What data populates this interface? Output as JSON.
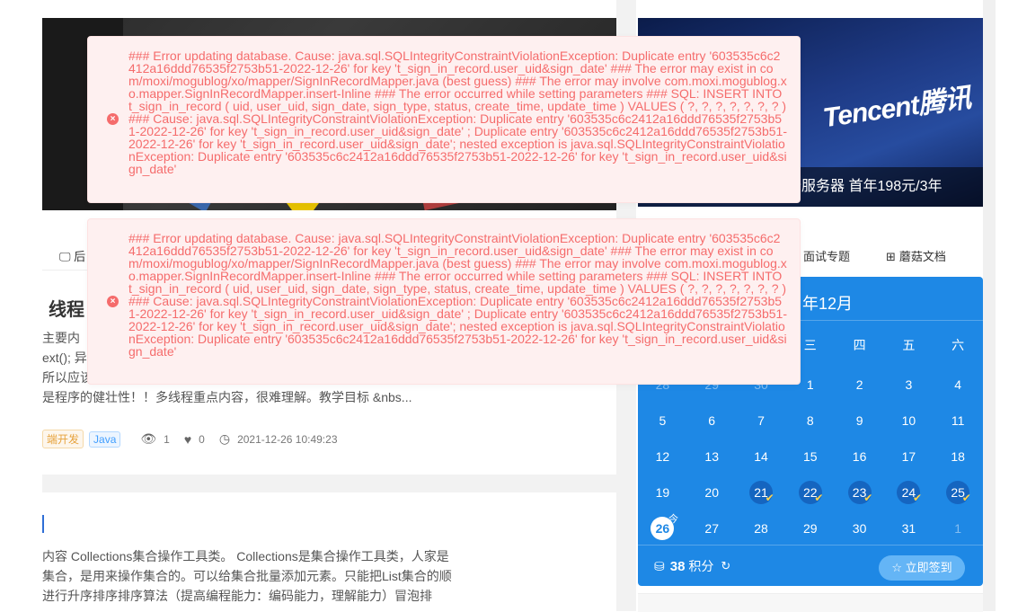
{
  "banner_right": {
    "logo": "Tencent腾讯",
    "caption": "云服务器 首年198元/3年"
  },
  "nav": {
    "left_tab": "后",
    "right_tabs": [
      {
        "icon": "",
        "label": "面试专题"
      },
      {
        "icon": "⊞",
        "label": "蘑菇文档"
      }
    ]
  },
  "article1": {
    "title": "线程",
    "lines": [
      " 主要内",
      "ext(); 异",
      "所以应该",
      "是程序的健壮性！！多线程重点内容，很难理解。教学目标 &nbs..."
    ],
    "tags": [
      "端开发",
      "Java"
    ],
    "views": "1",
    "likes": "0",
    "datetime": "2021-12-26 10:49:23"
  },
  "article2": {
    "lines": [
      "内容 Collections集合操作工具类。 Collections是集合操作工具类，人家是",
      "集合，是用来操作集合的。可以给集合批量添加元素。只能把List集合的顺",
      "进行升序排序排序算法（提高编程能力：编码能力，理解能力）冒泡排"
    ]
  },
  "calendar": {
    "title": "年12月",
    "weekdays": [
      "",
      "",
      "",
      "三",
      "四",
      "五",
      "六"
    ],
    "weeks": [
      [
        {
          "d": "28",
          "dim": true
        },
        {
          "d": "29",
          "dim": true
        },
        {
          "d": "30",
          "dim": true
        },
        {
          "d": "1"
        },
        {
          "d": "2"
        },
        {
          "d": "3"
        },
        {
          "d": "4"
        }
      ],
      [
        {
          "d": "5"
        },
        {
          "d": "6"
        },
        {
          "d": "7"
        },
        {
          "d": "8"
        },
        {
          "d": "9"
        },
        {
          "d": "10"
        },
        {
          "d": "11"
        }
      ],
      [
        {
          "d": "12"
        },
        {
          "d": "13"
        },
        {
          "d": "14"
        },
        {
          "d": "15"
        },
        {
          "d": "16"
        },
        {
          "d": "17"
        },
        {
          "d": "18"
        }
      ],
      [
        {
          "d": "19"
        },
        {
          "d": "20"
        },
        {
          "d": "21",
          "signed": true
        },
        {
          "d": "22",
          "signed": true
        },
        {
          "d": "23",
          "signed": true
        },
        {
          "d": "24",
          "signed": true
        },
        {
          "d": "25",
          "signed": true
        }
      ],
      [
        {
          "d": "26",
          "today": true
        },
        {
          "d": "27"
        },
        {
          "d": "28"
        },
        {
          "d": "29"
        },
        {
          "d": "30"
        },
        {
          "d": "31"
        },
        {
          "d": "1",
          "dim": true
        }
      ]
    ],
    "today_label": "今",
    "points_value": "38",
    "points_label": "积分",
    "sign_button": "☆ 立即签到"
  },
  "errors": [
    "### Error updating database. Cause: java.sql.SQLIntegrityConstraintViolationException: Duplicate entry '603535c6c2412a16ddd76535f2753b51-2022-12-26' for key 't_sign_in_record.user_uid&sign_date' ### The error may exist in com/moxi/mogublog/xo/mapper/SignInRecordMapper.java (best guess) ### The error may involve com.moxi.mogublog.xo.mapper.SignInRecordMapper.insert-Inline ### The error occurred while setting parameters ### SQL: INSERT INTO t_sign_in_record ( uid, user_uid, sign_date, sign_type, status, create_time, update_time ) VALUES ( ?, ?, ?, ?, ?, ?, ? ) ### Cause: java.sql.SQLIntegrityConstraintViolationException: Duplicate entry '603535c6c2412a16ddd76535f2753b51-2022-12-26' for key 't_sign_in_record.user_uid&sign_date' ; Duplicate entry '603535c6c2412a16ddd76535f2753b51-2022-12-26' for key 't_sign_in_record.user_uid&sign_date'; nested exception is java.sql.SQLIntegrityConstraintViolationException: Duplicate entry '603535c6c2412a16ddd76535f2753b51-2022-12-26' for key 't_sign_in_record.user_uid&sign_date'",
    "### Error updating database. Cause: java.sql.SQLIntegrityConstraintViolationException: Duplicate entry '603535c6c2412a16ddd76535f2753b51-2022-12-26' for key 't_sign_in_record.user_uid&sign_date' ### The error may exist in com/moxi/mogublog/xo/mapper/SignInRecordMapper.java (best guess) ### The error may involve com.moxi.mogublog.xo.mapper.SignInRecordMapper.insert-Inline ### The error occurred while setting parameters ### SQL: INSERT INTO t_sign_in_record ( uid, user_uid, sign_date, sign_type, status, create_time, update_time ) VALUES ( ?, ?, ?, ?, ?, ?, ? ) ### Cause: java.sql.SQLIntegrityConstraintViolationException: Duplicate entry '603535c6c2412a16ddd76535f2753b51-2022-12-26' for key 't_sign_in_record.user_uid&sign_date' ; Duplicate entry '603535c6c2412a16ddd76535f2753b51-2022-12-26' for key 't_sign_in_record.user_uid&sign_date'; nested exception is java.sql.SQLIntegrityConstraintViolationException: Duplicate entry '603535c6c2412a16ddd76535f2753b51-2022-12-26' for key 't_sign_in_record.user_uid&sign_date'"
  ],
  "colors": {
    "error_text": "#f56c6c",
    "error_bg": "#fef0f0",
    "calendar_bg": "#1e88e5",
    "signed_check": "#ffd54f"
  }
}
